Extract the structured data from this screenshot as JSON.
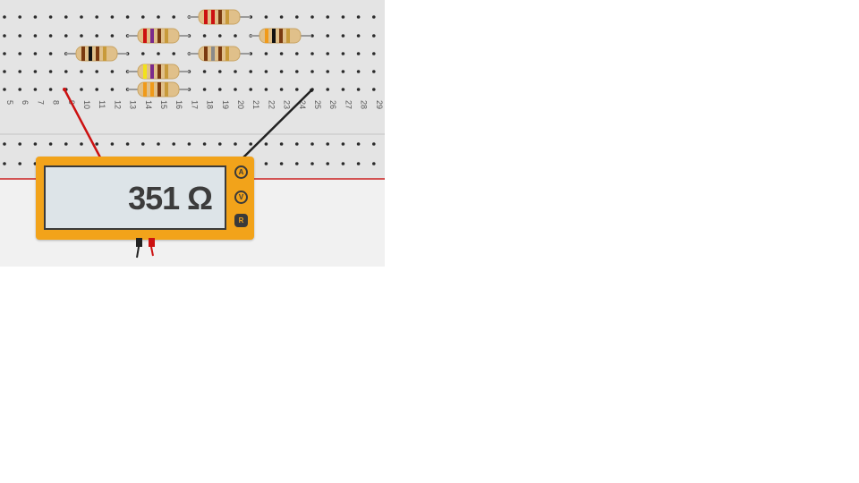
{
  "breadboard": {
    "column_numbers": [
      "5",
      "6",
      "7",
      "8",
      "9",
      "10",
      "11",
      "12",
      "13",
      "14",
      "15",
      "16",
      "17",
      "18",
      "19",
      "20",
      "21",
      "22",
      "23",
      "24",
      "25",
      "26",
      "27",
      "28",
      "29"
    ],
    "colors": {
      "board": "#e4e4e4",
      "hole": "#2b2b2b",
      "rail_line": "#cc2222"
    }
  },
  "resistors": [
    {
      "name": "resistor-1",
      "bands": [
        "#cc1111",
        "#cc1111",
        "#7a3a10",
        "#c89a3a"
      ]
    },
    {
      "name": "resistor-2",
      "bands": [
        "#cc1111",
        "#7b2a8c",
        "#7a3a10",
        "#c89a3a"
      ]
    },
    {
      "name": "resistor-3",
      "bands": [
        "#f09a1a",
        "#111111",
        "#7a3a10",
        "#c89a3a"
      ]
    },
    {
      "name": "resistor-4",
      "bands": [
        "#7a3a10",
        "#111111",
        "#7a3a10",
        "#c89a3a"
      ]
    },
    {
      "name": "resistor-5",
      "bands": [
        "#7a3a10",
        "#8a8a8a",
        "#7a3a10",
        "#c89a3a"
      ]
    },
    {
      "name": "resistor-6",
      "bands": [
        "#f2e21a",
        "#7b2a8c",
        "#7a3a10",
        "#c89a3a"
      ]
    },
    {
      "name": "resistor-7",
      "bands": [
        "#f09a1a",
        "#f09a1a",
        "#7a3a10",
        "#c89a3a"
      ]
    }
  ],
  "multimeter": {
    "reading": "351 Ω",
    "modes": [
      {
        "label": "A",
        "active": false
      },
      {
        "label": "V",
        "active": false
      },
      {
        "label": "R",
        "active": true
      }
    ],
    "colors": {
      "body": "#f2a31a",
      "screen": "#dde4e8",
      "probe_red": "#cc1111",
      "probe_black": "#222222"
    }
  }
}
